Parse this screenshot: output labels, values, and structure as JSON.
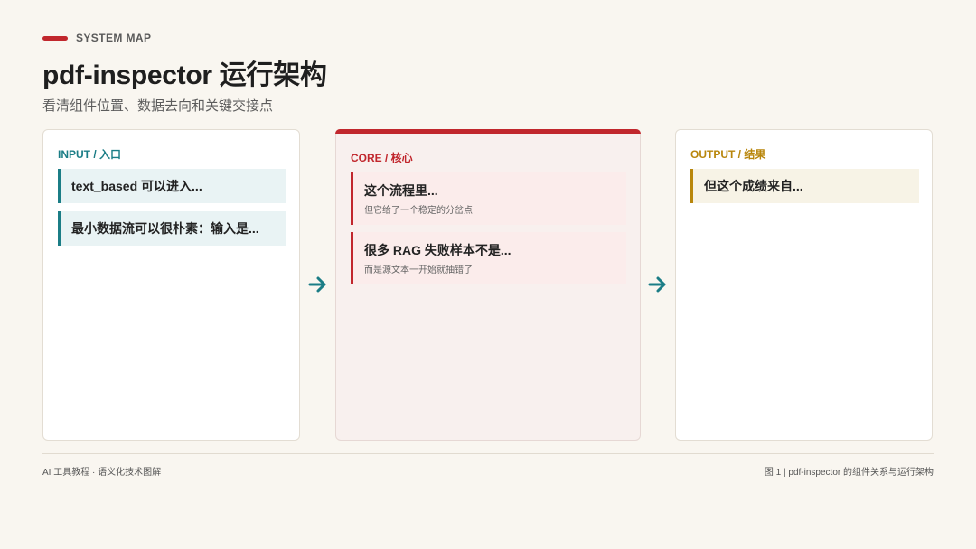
{
  "header": {
    "kicker": "SYSTEM MAP",
    "title": "pdf-inspector 运行架构",
    "subtitle": "看清组件位置、数据去向和关键交接点"
  },
  "panels": {
    "input": {
      "label": "INPUT / 入口",
      "cards": [
        {
          "title": "text_based 可以进入..."
        },
        {
          "title": "最小数据流可以很朴素：输入是..."
        }
      ]
    },
    "core": {
      "label": "CORE / 核心",
      "cards": [
        {
          "title": "这个流程里...",
          "subtitle": "但它给了一个稳定的分岔点"
        },
        {
          "title": "很多 RAG 失败样本不是...",
          "subtitle": "而是源文本一开始就抽错了"
        }
      ]
    },
    "output": {
      "label": "OUTPUT / 结果",
      "cards": [
        {
          "title": "但这个成绩来自..."
        }
      ]
    }
  },
  "footer": {
    "left": "AI 工具教程 · 语义化技术图解",
    "right": "图 1 | pdf-inspector 的组件关系与运行架构"
  },
  "colors": {
    "background": "#f9f6f0",
    "accent_red": "#c1272d",
    "input_teal": "#1b7d86",
    "output_gold": "#b8860b"
  },
  "icons": [
    "arrow-right-icon",
    "arrow-right-icon"
  ]
}
